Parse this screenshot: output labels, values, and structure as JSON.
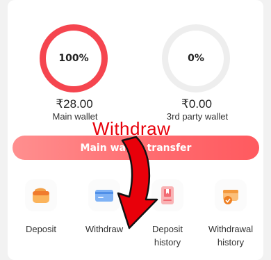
{
  "main_wallet": {
    "percent": "100%",
    "percent_value": 1.0,
    "amount": "₹28.00",
    "label": "Main wallet",
    "ring_color": "#f5454f"
  },
  "third_party_wallet": {
    "percent": "0%",
    "percent_value": 0.0,
    "amount": "₹0.00",
    "label": "3rd party wallet",
    "ring_color": "#eeeeee"
  },
  "transfer_button": {
    "label": "Main wallet transfer"
  },
  "annotation": {
    "text": "Withdraw",
    "color": "#e8000a"
  },
  "actions": [
    {
      "label": "Deposit",
      "icon": "deposit-wallet-icon"
    },
    {
      "label": "Withdraw",
      "icon": "withdraw-card-icon"
    },
    {
      "label": "Deposit history",
      "icon": "deposit-history-icon"
    },
    {
      "label": "Withdrawal history",
      "icon": "withdrawal-history-icon"
    }
  ]
}
